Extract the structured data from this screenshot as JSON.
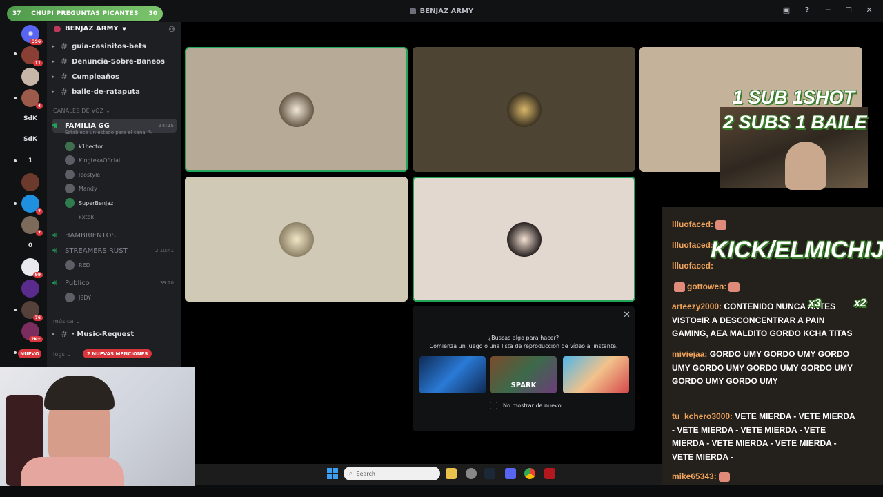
{
  "window": {
    "title": "BENJAZ ARMY"
  },
  "overlay_pill": {
    "left": "37",
    "text": "CHUPI PREGUNTAS PICANTES",
    "right": "30"
  },
  "rail": {
    "items": [
      {
        "label": "",
        "badge": "396"
      },
      {
        "label": "",
        "badge": "11"
      },
      {
        "label": "",
        "badge": ""
      },
      {
        "label": "",
        "badge": "4"
      },
      {
        "label": "SdK",
        "badge": ""
      },
      {
        "label": "SdK",
        "badge": ""
      },
      {
        "label": "1",
        "badge": ""
      },
      {
        "label": "",
        "badge": ""
      },
      {
        "label": "",
        "badge": "7"
      },
      {
        "label": "",
        "badge": "7"
      },
      {
        "label": "0",
        "badge": ""
      },
      {
        "label": "",
        "badge": "99"
      },
      {
        "label": "",
        "badge": ""
      },
      {
        "label": "",
        "badge": "76"
      },
      {
        "label": "",
        "badge": "2K+"
      }
    ]
  },
  "server": {
    "name": "BENJAZ ARMY"
  },
  "text_channels": [
    "guia-casinitos-bets",
    "Denuncia-Sobre-Baneos",
    "Cumpleaños",
    "baile-de-rataputa"
  ],
  "voice_category": "CANALES DE VOZ",
  "voice_channels": {
    "familia": {
      "name": "FAMILIA GG",
      "time": "34:25",
      "status": "Establece un estado para el canal"
    },
    "familia_members": [
      "k1hector",
      "KingtekaOficial",
      "leostyle",
      "Mandy",
      "SuperBenjaz",
      "xxtok"
    ],
    "hambrientos": "HAMBRIENTOS",
    "streamers": {
      "name": "STREAMERS RUST",
      "time": "2:10:41",
      "member": "RED"
    },
    "publico": {
      "name": "Publico",
      "time": "39:20",
      "member": "JEDY"
    }
  },
  "music_category": "música",
  "music_channel": "· Music-Request",
  "logs_category": "logs",
  "tags": {
    "nuevo": "NUEVO",
    "menciones": "2 NUEVAS MENCIONES"
  },
  "popup": {
    "question": "¿Buscas algo para hacer?",
    "subtitle": "Comienza un juego o una lista de reproducción de vídeo al instante.",
    "thumb_label": "SPARK",
    "checkbox": "No mostrar de nuevo"
  },
  "taskbar": {
    "search_placeholder": "Search"
  },
  "stickers": {
    "sub1": "1 SUB  1SHOT",
    "sub2": "2 SUBS 1 BAILE",
    "kick": "KICK/ELMICHIJ",
    "x3": "x3",
    "x2": "x2"
  },
  "chat": [
    {
      "user": "llluofaced:",
      "text": ""
    },
    {
      "user": "llluofaced:",
      "text": ""
    },
    {
      "user": "llluofaced:",
      "text": ""
    },
    {
      "user": "gottowen:",
      "text": ""
    },
    {
      "user": "arteezy2000:",
      "text": "CONTENIDO NUNCA ANTES VISTO=IR A DESCONCENTRAR A PAIN GAMING, AEA MALDITO GORDO KCHA TITAS"
    },
    {
      "user": "miviejaa:",
      "text": "GORDO UMY  GORDO UMY  GORDO UMY  GORDO UMY  GORDO UMY  GORDO UMY  GORDO UMY  GORDO UMY"
    },
    {
      "user": "tu_kchero3000:",
      "text": "VETE MIERDA - VETE MIERDA - VETE MIERDA - VETE MIERDA - VETE MIERDA - VETE MIERDA - VETE MIERDA - VETE MIERDA -"
    },
    {
      "user": "mike65343:",
      "text": ""
    }
  ],
  "colors": {
    "speaking": "#23a559",
    "badge": "#da373c",
    "chat_user": "#f0a35a",
    "sticker_outline": "#3a7d2c"
  }
}
